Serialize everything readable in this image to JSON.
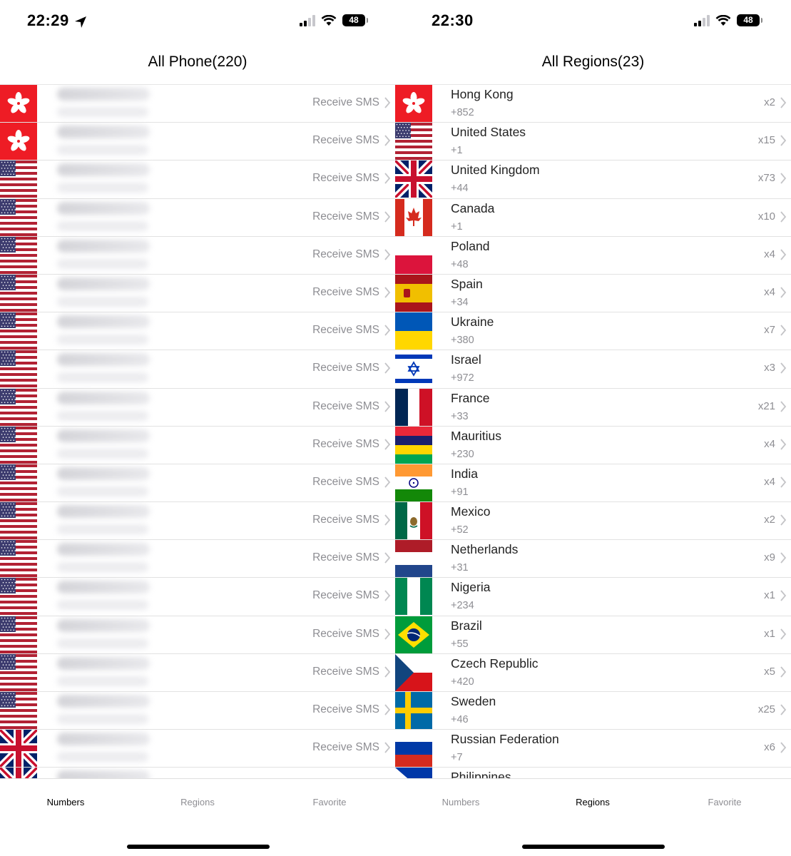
{
  "left": {
    "status": {
      "time": "22:29",
      "battery": "48"
    },
    "title": "All Phone(220)",
    "sms_label": "Receive SMS",
    "rows": [
      {
        "flag": "hk"
      },
      {
        "flag": "hk"
      },
      {
        "flag": "us"
      },
      {
        "flag": "us"
      },
      {
        "flag": "us"
      },
      {
        "flag": "us"
      },
      {
        "flag": "us"
      },
      {
        "flag": "us"
      },
      {
        "flag": "us"
      },
      {
        "flag": "us"
      },
      {
        "flag": "us"
      },
      {
        "flag": "us"
      },
      {
        "flag": "us"
      },
      {
        "flag": "us"
      },
      {
        "flag": "us"
      },
      {
        "flag": "us"
      },
      {
        "flag": "us"
      },
      {
        "flag": "gb"
      },
      {
        "flag": "gb"
      }
    ],
    "tabs": [
      "Numbers",
      "Regions",
      "Favorite"
    ],
    "active_tab": 0
  },
  "right": {
    "status": {
      "time": "22:30",
      "battery": "48"
    },
    "title": "All Regions(23)",
    "regions": [
      {
        "flag": "hk",
        "name": "Hong Kong",
        "code": "+852",
        "count": "x2"
      },
      {
        "flag": "us",
        "name": "United States",
        "code": "+1",
        "count": "x15"
      },
      {
        "flag": "gb",
        "name": "United Kingdom",
        "code": "+44",
        "count": "x73"
      },
      {
        "flag": "ca",
        "name": "Canada",
        "code": "+1",
        "count": "x10"
      },
      {
        "flag": "pl",
        "name": "Poland",
        "code": "+48",
        "count": "x4"
      },
      {
        "flag": "es",
        "name": "Spain",
        "code": "+34",
        "count": "x4"
      },
      {
        "flag": "ua",
        "name": "Ukraine",
        "code": "+380",
        "count": "x7"
      },
      {
        "flag": "il",
        "name": "Israel",
        "code": "+972",
        "count": "x3"
      },
      {
        "flag": "fr",
        "name": "France",
        "code": "+33",
        "count": "x21"
      },
      {
        "flag": "mu",
        "name": "Mauritius",
        "code": "+230",
        "count": "x4"
      },
      {
        "flag": "in",
        "name": "India",
        "code": "+91",
        "count": "x4"
      },
      {
        "flag": "mx",
        "name": "Mexico",
        "code": "+52",
        "count": "x2"
      },
      {
        "flag": "nl",
        "name": "Netherlands",
        "code": "+31",
        "count": "x9"
      },
      {
        "flag": "ng",
        "name": "Nigeria",
        "code": "+234",
        "count": "x1"
      },
      {
        "flag": "br",
        "name": "Brazil",
        "code": "+55",
        "count": "x1"
      },
      {
        "flag": "cz",
        "name": "Czech Republic",
        "code": "+420",
        "count": "x5"
      },
      {
        "flag": "se",
        "name": "Sweden",
        "code": "+46",
        "count": "x25"
      },
      {
        "flag": "ru",
        "name": "Russian Federation",
        "code": "+7",
        "count": "x6"
      },
      {
        "flag": "ph",
        "name": "Philippines",
        "code": "",
        "count": ""
      }
    ],
    "tabs": [
      "Numbers",
      "Regions",
      "Favorite"
    ],
    "active_tab": 1
  }
}
